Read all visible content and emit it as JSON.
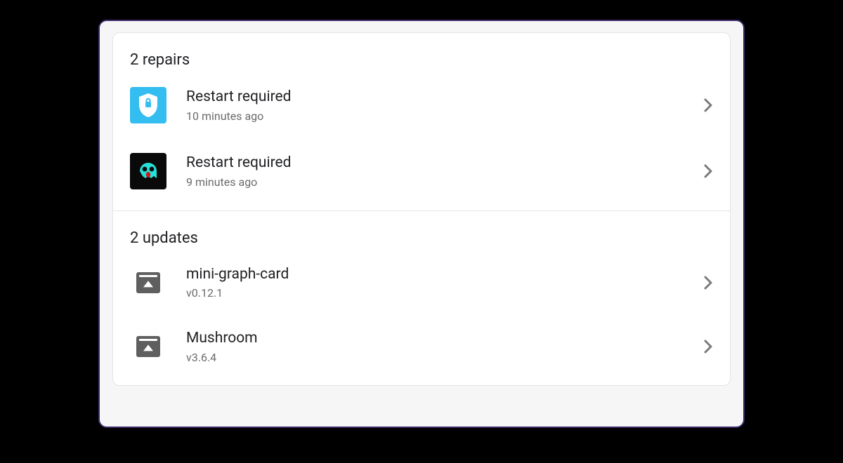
{
  "repairs": {
    "heading": "2 repairs",
    "items": [
      {
        "title": "Restart required",
        "subtitle": "10 minutes ago"
      },
      {
        "title": "Restart required",
        "subtitle": "9 minutes ago"
      }
    ]
  },
  "updates": {
    "heading": "2 updates",
    "items": [
      {
        "title": "mini-graph-card",
        "subtitle": "v0.12.1"
      },
      {
        "title": "Mushroom",
        "subtitle": "v3.6.4"
      }
    ]
  }
}
